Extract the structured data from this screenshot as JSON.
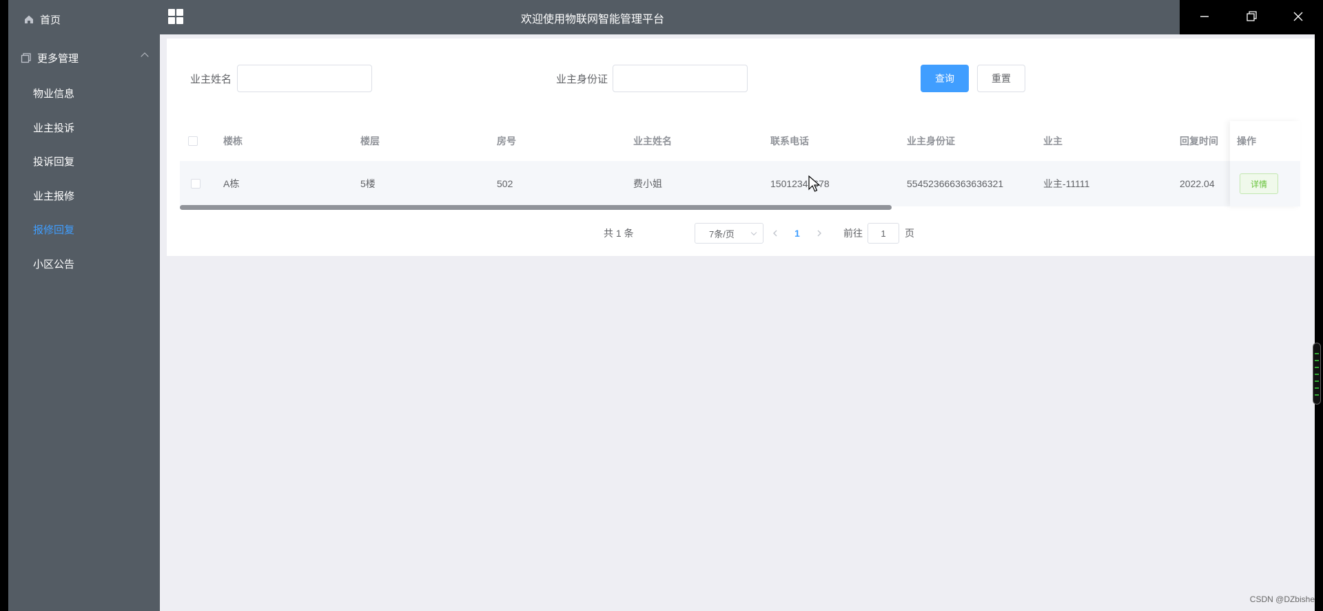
{
  "app": {
    "title": "欢迎使用物联网智能管理平台"
  },
  "sidebar": {
    "home_label": "首页",
    "more_label": "更多管理",
    "items": [
      {
        "label": "物业信息"
      },
      {
        "label": "业主投诉"
      },
      {
        "label": "投诉回复"
      },
      {
        "label": "业主报修"
      },
      {
        "label": "报修回复",
        "active": true
      },
      {
        "label": "小区公告"
      }
    ]
  },
  "search": {
    "owner_name_label": "业主姓名",
    "owner_name_value": "",
    "owner_id_label": "业主身份证",
    "owner_id_value": "",
    "query_button": "查询",
    "reset_button": "重置"
  },
  "table": {
    "columns": [
      "楼栋",
      "楼层",
      "房号",
      "业主姓名",
      "联系电话",
      "业主身份证",
      "业主",
      "回复时间",
      "操作"
    ],
    "rows": [
      {
        "building": "A栋",
        "floor": "5楼",
        "room": "502",
        "owner_name": "费小姐",
        "phone": "15012345678",
        "id_card": "554523666363636321",
        "owner": "业主-11111",
        "reply_time": "2022.04",
        "action": "详情"
      }
    ]
  },
  "pagination": {
    "total": "共 1 条",
    "page_size": "7条/页",
    "current_page": "1",
    "goto_label": "前往",
    "goto_value": "1",
    "page_unit": "页"
  },
  "watermark": "CSDN @DZbishe",
  "colors": {
    "sidebar": "#545c64",
    "accent": "#409eff",
    "success": "#67c23a",
    "content_bg": "#eeeef3"
  }
}
